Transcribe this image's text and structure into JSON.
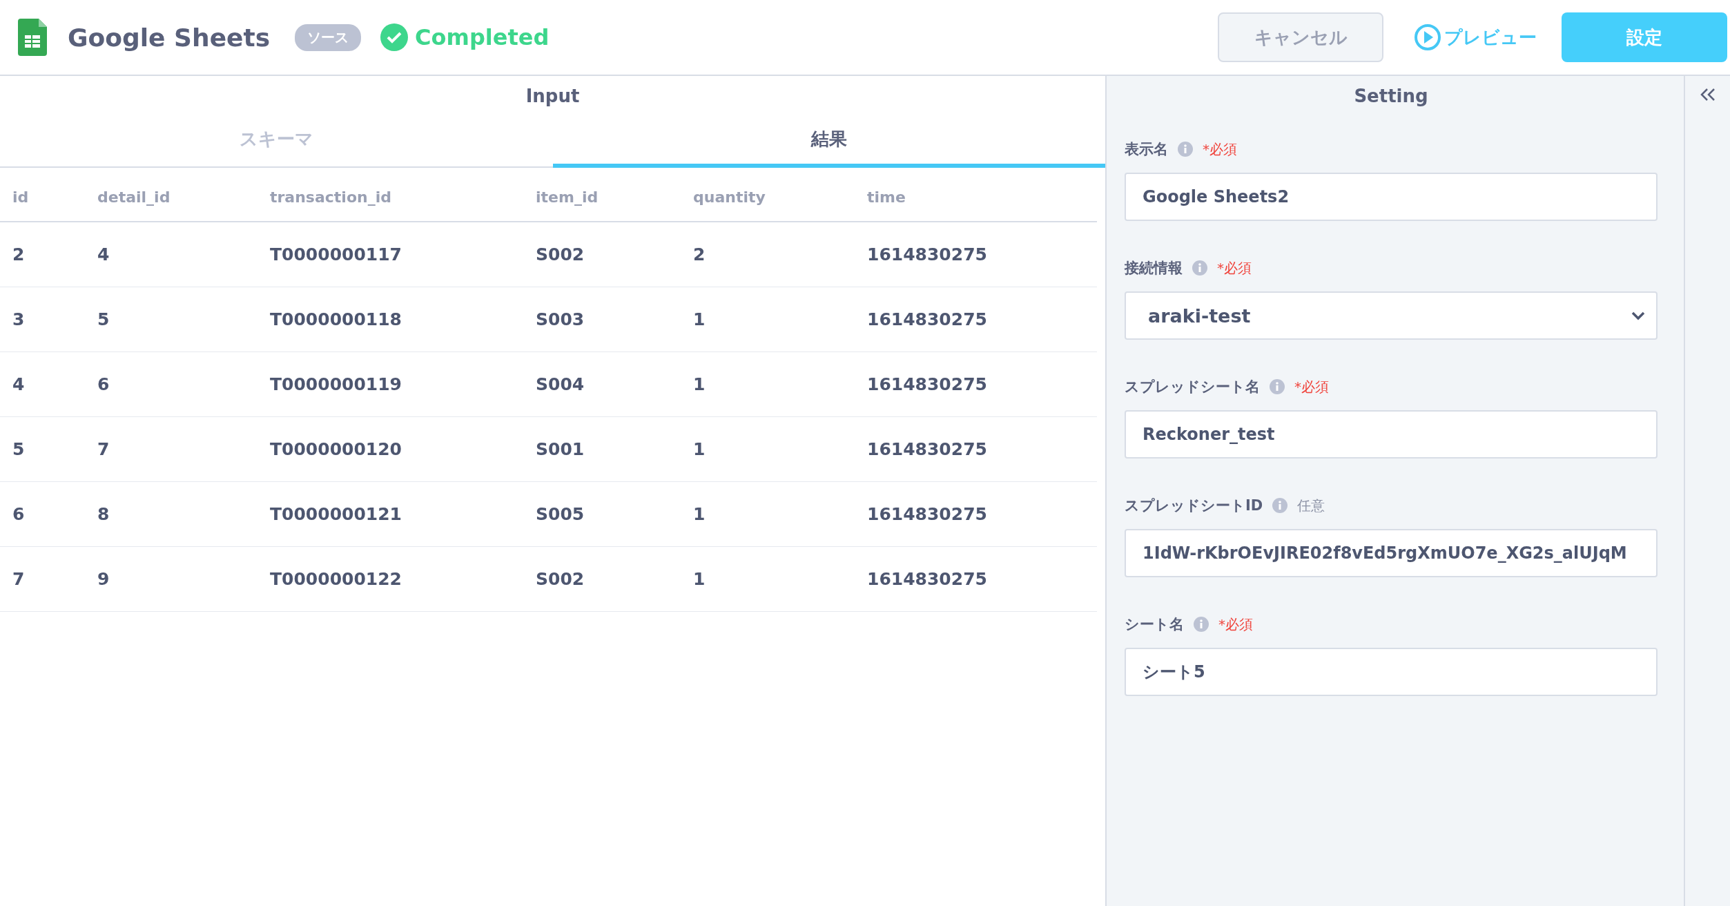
{
  "header": {
    "title": "Google Sheets",
    "badge": "ソース",
    "status": "Completed",
    "cancel": "キャンセル",
    "preview": "プレビュー",
    "submit": "設定"
  },
  "input": {
    "title": "Input",
    "tabs": [
      {
        "label": "スキーマ",
        "selected": false
      },
      {
        "label": "結果",
        "selected": true
      }
    ],
    "table": {
      "columns": [
        "id",
        "detail_id",
        "transaction_id",
        "item_id",
        "quantity",
        "time"
      ],
      "rows": [
        [
          "2",
          "4",
          "T0000000117",
          "S002",
          "2",
          "1614830275"
        ],
        [
          "3",
          "5",
          "T0000000118",
          "S003",
          "1",
          "1614830275"
        ],
        [
          "4",
          "6",
          "T0000000119",
          "S004",
          "1",
          "1614830275"
        ],
        [
          "5",
          "7",
          "T0000000120",
          "S001",
          "1",
          "1614830275"
        ],
        [
          "6",
          "8",
          "T0000000121",
          "S005",
          "1",
          "1614830275"
        ],
        [
          "7",
          "9",
          "T0000000122",
          "S002",
          "1",
          "1614830275"
        ]
      ]
    }
  },
  "setting": {
    "title": "Setting",
    "fields": [
      {
        "label": "表示名",
        "tag": "*必須",
        "required": true,
        "kind": "input",
        "value": "Google Sheets2"
      },
      {
        "label": "接続情報",
        "tag": "*必須",
        "required": true,
        "kind": "select",
        "value": "araki-test"
      },
      {
        "label": "スプレッドシート名",
        "tag": "*必須",
        "required": true,
        "kind": "input",
        "value": "Reckoner_test"
      },
      {
        "label": "スプレッドシートID",
        "tag": "任意",
        "required": false,
        "kind": "input",
        "value": "1IdW-rKbrOEvJIRE02f8vEd5rgXmUO7e_XG2s_alUJqM"
      },
      {
        "label": "シート名",
        "tag": "*必須",
        "required": true,
        "kind": "input",
        "value": "シート5"
      }
    ]
  }
}
